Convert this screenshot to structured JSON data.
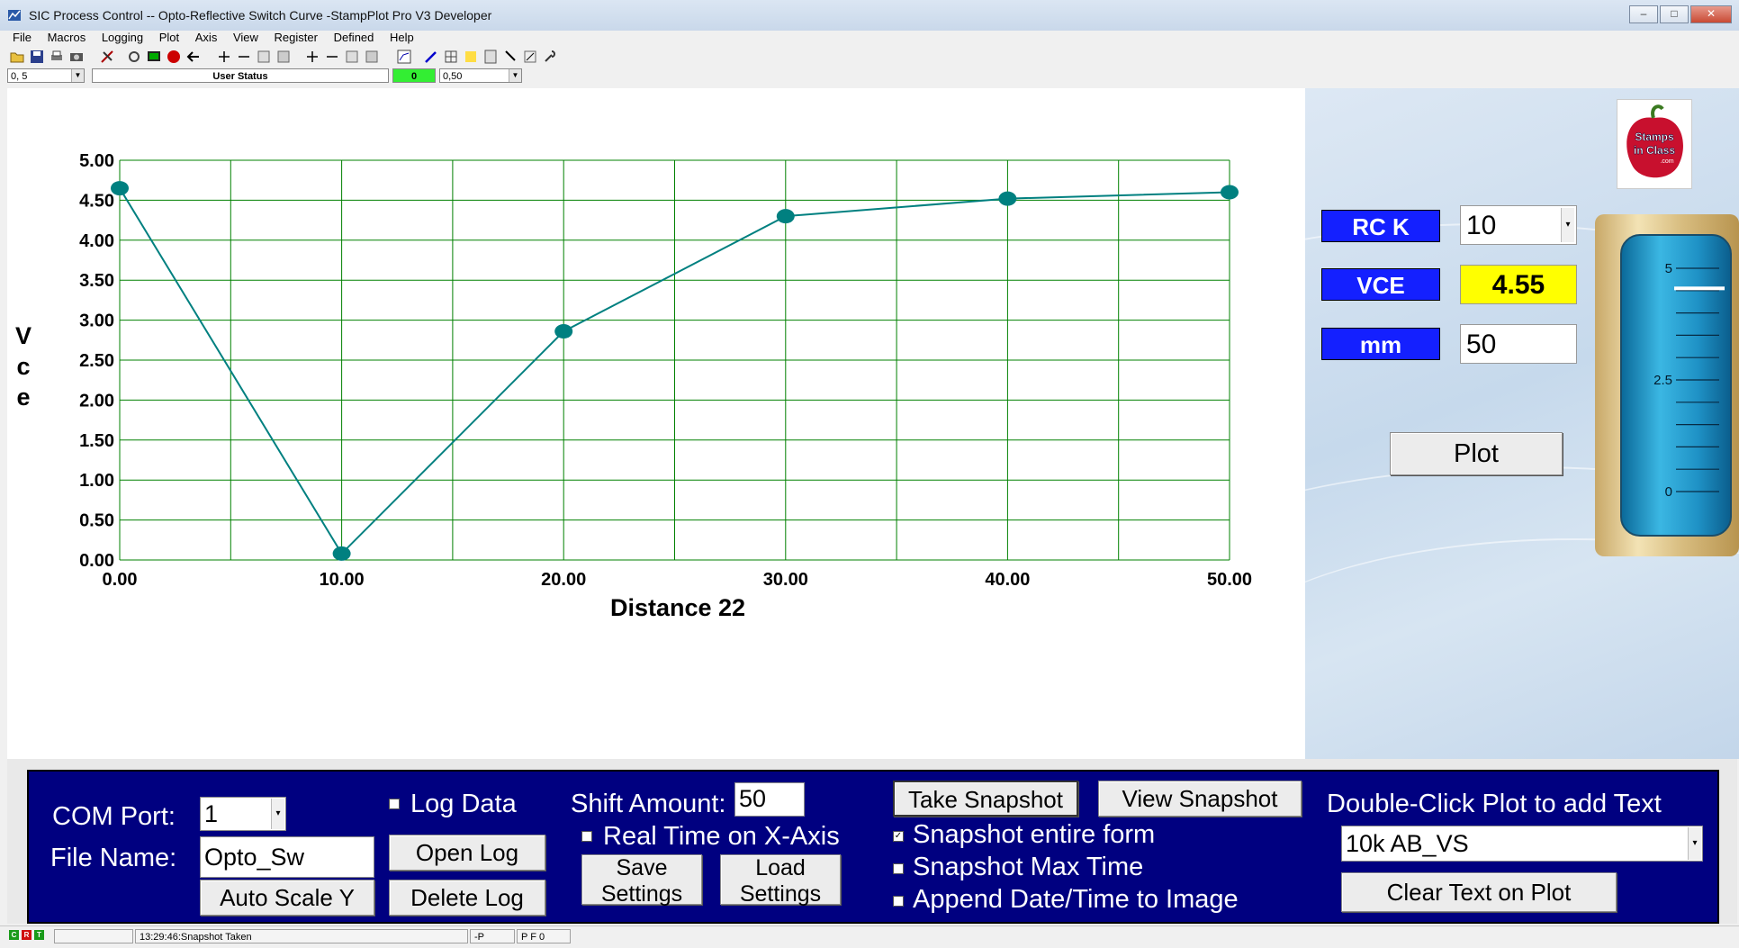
{
  "window": {
    "title": "SIC Process Control -- Opto-Reflective Switch Curve -StampPlot Pro V3 Developer",
    "minimize": "–",
    "maximize": "□",
    "close": "✕"
  },
  "menu": [
    "File",
    "Macros",
    "Logging",
    "Plot",
    "Axis",
    "View",
    "Register",
    "Defined",
    "Help"
  ],
  "toolbar_row2": {
    "combo_left": "0, 5",
    "user_status": "User Status",
    "green_value": "0",
    "combo_right": "0,50"
  },
  "chart_data": {
    "type": "line",
    "x": [
      0,
      10,
      20,
      30,
      40,
      50
    ],
    "y": [
      4.65,
      0.08,
      2.86,
      4.3,
      4.52,
      4.6
    ],
    "xlabel": "Distance 22",
    "ylabel": "Vce",
    "ylabel_chars": [
      "V",
      "c",
      "e"
    ],
    "xlim": [
      0,
      50
    ],
    "ylim": [
      0,
      5
    ],
    "x_ticks": [
      "0.00",
      "10.00",
      "20.00",
      "30.00",
      "40.00",
      "50.00"
    ],
    "y_ticks": [
      "0.00",
      "0.50",
      "1.00",
      "1.50",
      "2.00",
      "2.50",
      "3.00",
      "3.50",
      "4.00",
      "4.50",
      "5.00"
    ],
    "grid": true,
    "line_color": "#008080",
    "grid_color": "#008000"
  },
  "right_panel": {
    "logo_text": [
      "Stamps",
      "in Class",
      ".com"
    ],
    "rck_label": "RC K",
    "rck_value": "10",
    "vce_label": "VCE",
    "vce_value": "4.55",
    "mm_label": "mm",
    "mm_value": "50",
    "plot_button": "Plot",
    "meter": {
      "labels": [
        "5",
        "2.5",
        "0"
      ],
      "min": 0,
      "max": 5,
      "value": 4.55
    }
  },
  "bottom": {
    "com_port_label": "COM Port:",
    "com_port_value": "1",
    "file_name_label": "File Name:",
    "file_name_value": "Opto_Sw",
    "auto_scale": "Auto Scale Y",
    "log_data": "Log Data",
    "open_log": "Open Log",
    "delete_log": "Delete Log",
    "shift_label": "Shift Amount:",
    "shift_value": "50",
    "real_time": "Real Time on X-Axis",
    "save_settings": [
      "Save",
      "Settings"
    ],
    "load_settings": [
      "Load",
      "Settings"
    ],
    "take_snapshot": "Take Snapshot",
    "view_snapshot": "View Snapshot",
    "snap_entire": "Snapshot entire form",
    "snap_max": "Snapshot Max Time",
    "append_date": "Append Date/Time to Image",
    "checks": {
      "log_data": false,
      "real_time": false,
      "snap_entire": true,
      "snap_max": false,
      "append_date": false
    },
    "dbl_click": "Double-Click Plot to add Text",
    "text_combo": "10k AB_VS",
    "clear_text": "Clear Text on Plot"
  },
  "status": {
    "leds": [
      "C",
      "R",
      "T"
    ],
    "time_msg": "13:29:46:Snapshot Taken",
    "p": "-P",
    "pf": "P F 0"
  }
}
